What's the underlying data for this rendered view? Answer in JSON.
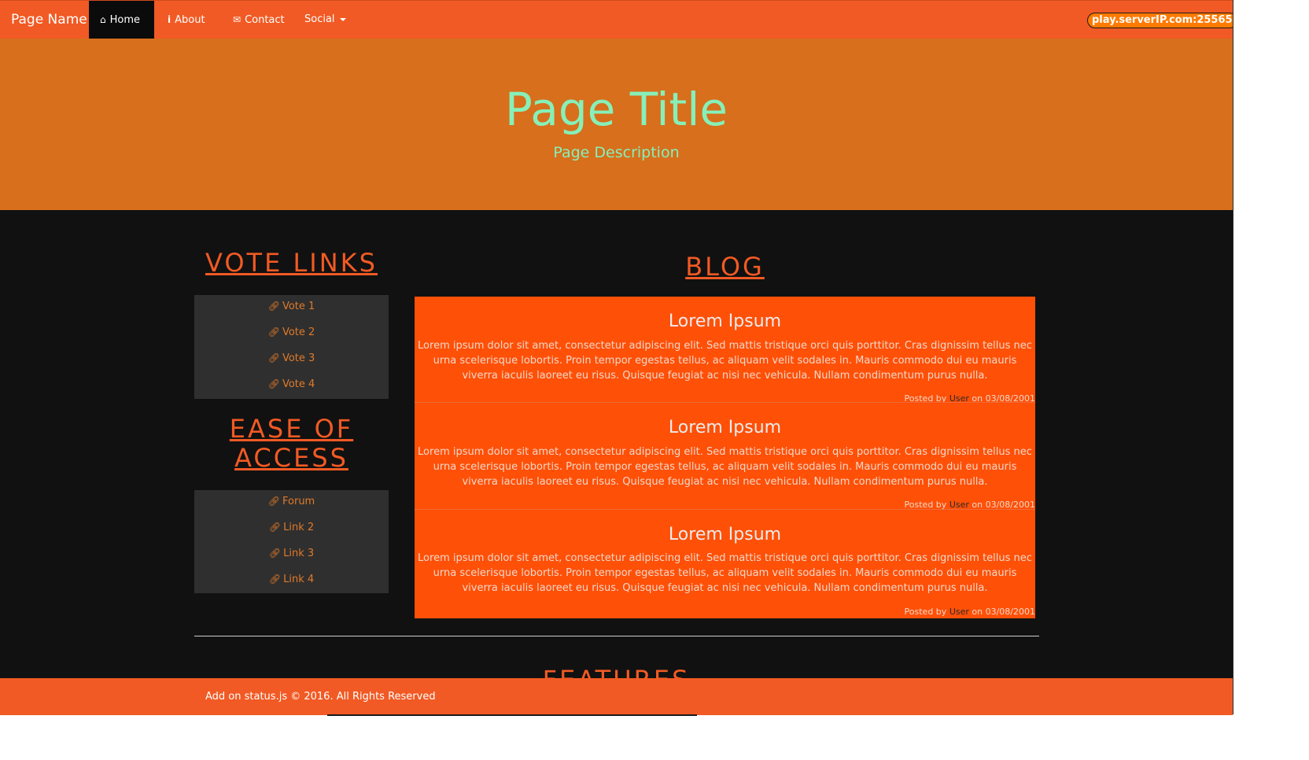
{
  "colors": {
    "navbar": "#f15a24",
    "header": "#d76f1c",
    "body": "#111111",
    "accent": "#f15a24",
    "blog_box": "#ff5008",
    "title_text": "#86f0b8",
    "panel": "#2f2f2f",
    "link": "#e07a2a"
  },
  "nav": {
    "brand": "Page Name",
    "items": [
      {
        "label": "Home",
        "icon": "home-icon",
        "active": true
      },
      {
        "label": "About",
        "icon": "info-icon",
        "active": false
      },
      {
        "label": "Contact",
        "icon": "envelope-icon",
        "active": false
      },
      {
        "label": "Social",
        "icon": "caret-down-icon",
        "active": false
      }
    ],
    "server_ip": "play.serverIP.com:25565"
  },
  "header": {
    "title": "Page Title",
    "description": "Page Description"
  },
  "sidebar": {
    "vote_heading": "VOTE LINKS",
    "vote_links": [
      {
        "label": "Vote 1",
        "icon": "link-icon"
      },
      {
        "label": "Vote 2",
        "icon": "link-icon"
      },
      {
        "label": "Vote 3",
        "icon": "link-icon"
      },
      {
        "label": "Vote 4",
        "icon": "link-icon"
      }
    ],
    "ease_heading_line1": "EASE OF",
    "ease_heading_line2": "ACCESS",
    "ease_links": [
      {
        "label": "Forum",
        "icon": "link-icon"
      },
      {
        "label": "Link 2",
        "icon": "link-icon"
      },
      {
        "label": "Link 3",
        "icon": "link-icon"
      },
      {
        "label": "Link 4",
        "icon": "link-icon"
      }
    ]
  },
  "blog": {
    "heading": "BLOG",
    "posts": [
      {
        "title": "Lorem Ipsum",
        "body": "Lorem ipsum dolor sit amet, consectetur adipiscing elit. Sed mattis tristique orci quis porttitor. Cras dignissim tellus nec urna scelerisque lobortis. Proin tempor egestas tellus, ac aliquam velit sodales in. Mauris commodo dui eu mauris viverra iaculis laoreet eu risus. Quisque feugiat ac nisi nec vehicula. Nullam condimentum purus nulla.",
        "posted_by_prefix": "Posted by ",
        "author": "User",
        "date_prefix": " on ",
        "date": "03/08/2001"
      },
      {
        "title": "Lorem Ipsum",
        "body": "Lorem ipsum dolor sit amet, consectetur adipiscing elit. Sed mattis tristique orci quis porttitor. Cras dignissim tellus nec urna scelerisque lobortis. Proin tempor egestas tellus, ac aliquam velit sodales in. Mauris commodo dui eu mauris viverra iaculis laoreet eu risus. Quisque feugiat ac nisi nec vehicula. Nullam condimentum purus nulla.",
        "posted_by_prefix": "Posted by ",
        "author": "User",
        "date_prefix": " on ",
        "date": "03/08/2001"
      },
      {
        "title": "Lorem Ipsum",
        "body": "Lorem ipsum dolor sit amet, consectetur adipiscing elit. Sed mattis tristique orci quis porttitor. Cras dignissim tellus nec urna scelerisque lobortis. Proin tempor egestas tellus, ac aliquam velit sodales in. Mauris commodo dui eu mauris viverra iaculis laoreet eu risus. Quisque feugiat ac nisi nec vehicula. Nullam condimentum purus nulla.",
        "posted_by_prefix": "Posted by ",
        "author": "User",
        "date_prefix": " on ",
        "date": "03/08/2001"
      }
    ]
  },
  "features_heading": "FEATURES",
  "footer": {
    "text": "Add on status.js © 2016. All Rights Reserved"
  }
}
